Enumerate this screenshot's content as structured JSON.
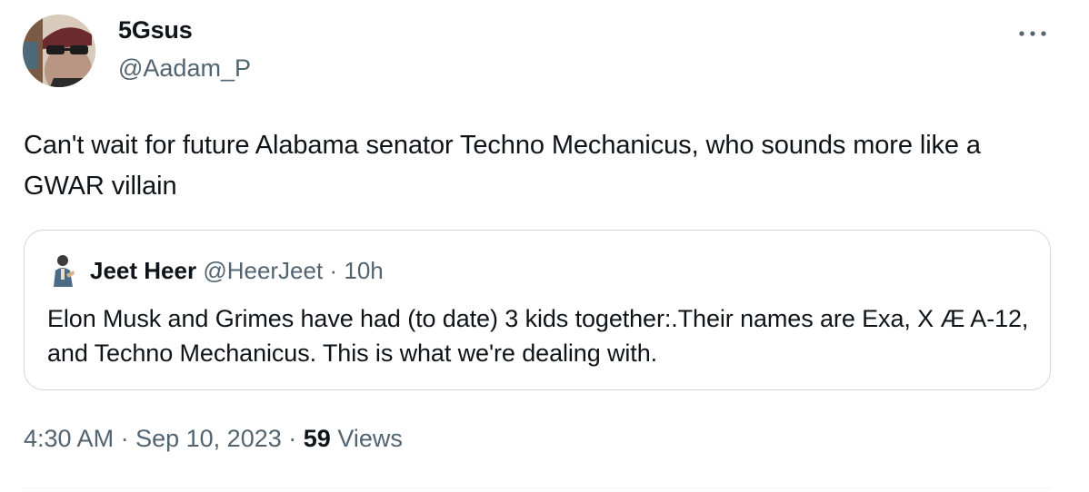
{
  "author": {
    "display_name": "5Gsus",
    "handle": "@Aadam_P"
  },
  "tweet": {
    "text": "Can't wait for future Alabama senator Techno Mechanicus, who sounds more like a GWAR villain"
  },
  "quoted_tweet": {
    "display_name": "Jeet Heer",
    "handle": "@HeerJeet",
    "separator": "·",
    "time": "10h",
    "text": "Elon Musk and Grimes have had (to date) 3 kids together:.Their names are Exa, X Æ A-12, and Techno Mechanicus. This is what we're dealing with."
  },
  "meta": {
    "time": "4:30 AM",
    "separator": "·",
    "date": "Sep 10, 2023",
    "views_count": "59",
    "views_label": "Views"
  },
  "icons": {
    "more": "more-horizontal-icon"
  }
}
